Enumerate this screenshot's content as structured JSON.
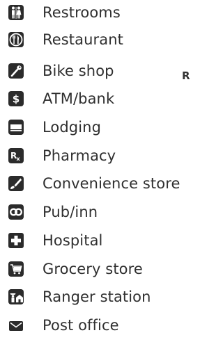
{
  "legend": {
    "items": [
      {
        "label": "Restrooms",
        "icon": "restrooms-icon"
      },
      {
        "label": "Restaurant",
        "icon": "restaurant-icon"
      },
      {
        "label": "Bike shop",
        "icon": "bike-shop-icon"
      },
      {
        "label": "ATM/bank",
        "icon": "atm-bank-icon"
      },
      {
        "label": "Lodging",
        "icon": "lodging-icon"
      },
      {
        "label": "Pharmacy",
        "icon": "pharmacy-icon"
      },
      {
        "label": "Convenience store",
        "icon": "convenience-store-icon"
      },
      {
        "label": "Pub/inn",
        "icon": "pub-inn-icon"
      },
      {
        "label": "Hospital",
        "icon": "hospital-icon"
      },
      {
        "label": "Grocery store",
        "icon": "grocery-store-icon"
      },
      {
        "label": "Ranger station",
        "icon": "ranger-station-icon"
      },
      {
        "label": "Post office",
        "icon": "post-office-icon"
      }
    ]
  },
  "edge_text": "R",
  "colors": {
    "icon": "#2b2b2b",
    "text": "#2f2f2f"
  }
}
